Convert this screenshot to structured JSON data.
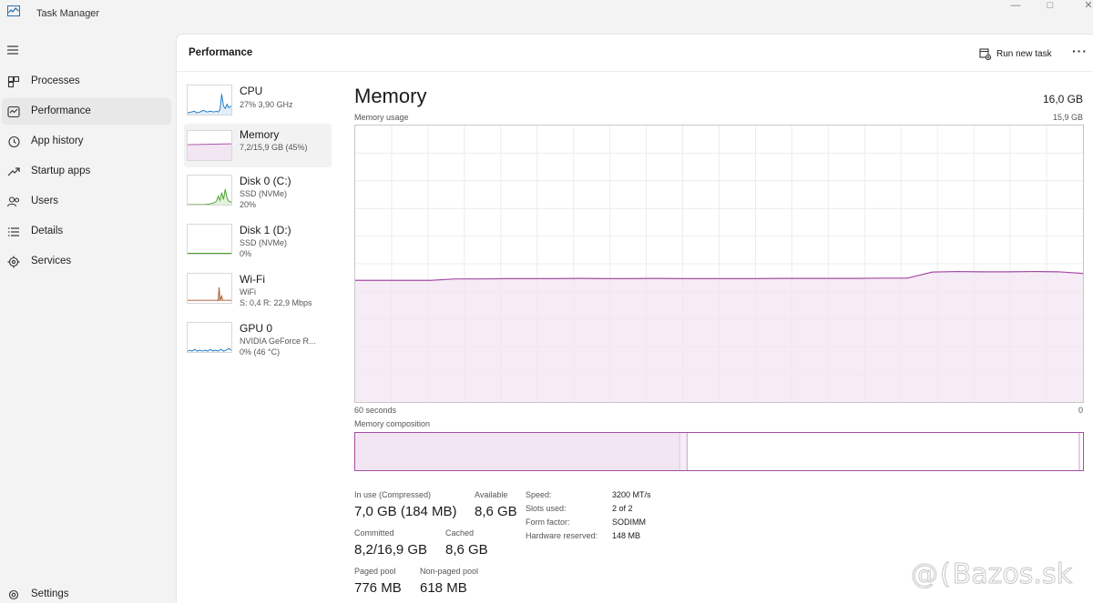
{
  "window": {
    "title": "Task Manager",
    "minimize": "—",
    "maximize": "□",
    "close": "✕"
  },
  "nav": {
    "items": [
      {
        "label": "Processes",
        "icon": "processes-icon"
      },
      {
        "label": "Performance",
        "icon": "performance-icon",
        "active": true
      },
      {
        "label": "App history",
        "icon": "app-history-icon"
      },
      {
        "label": "Startup apps",
        "icon": "startup-apps-icon"
      },
      {
        "label": "Users",
        "icon": "users-icon"
      },
      {
        "label": "Details",
        "icon": "details-icon"
      },
      {
        "label": "Services",
        "icon": "services-icon"
      }
    ],
    "settings": "Settings"
  },
  "header": {
    "title": "Performance",
    "run_new_task": "Run new task",
    "more": "···"
  },
  "devices": [
    {
      "name": "CPU",
      "sub1": "27% 3,90 GHz",
      "sub2": "",
      "sub3": "",
      "color": "#1c7ac8"
    },
    {
      "name": "Memory",
      "sub1": "7,2/15,9 GB (45%)",
      "sub2": "",
      "sub3": "",
      "color": "#a64ca6",
      "active": true
    },
    {
      "name": "Disk 0 (C:)",
      "sub1": "SSD (NVMe)",
      "sub2": "20%",
      "sub3": "",
      "color": "#4aa02c"
    },
    {
      "name": "Disk 1 (D:)",
      "sub1": "SSD (NVMe)",
      "sub2": "0%",
      "sub3": "",
      "color": "#4aa02c"
    },
    {
      "name": "Wi-Fi",
      "sub1": "WiFi",
      "sub2": "S: 0,4 R: 22,9 Mbps",
      "sub3": "",
      "color": "#a8562a"
    },
    {
      "name": "GPU 0",
      "sub1": "NVIDIA GeForce R...",
      "sub2": "0% (46 °C)",
      "sub3": "",
      "color": "#1c7ac8"
    }
  ],
  "memory": {
    "title": "Memory",
    "total": "16,0 GB",
    "usage_label": "Memory usage",
    "usage_max": "15,9 GB",
    "time_left": "60 seconds",
    "time_right": "0",
    "composition_label": "Memory composition",
    "composition": {
      "in_use_fraction": 0.446,
      "modified_fraction": 0.01,
      "free_fraction": 0.005
    },
    "usage_series": [
      0.44,
      0.44,
      0.44,
      0.44,
      0.445,
      0.445,
      0.446,
      0.446,
      0.446,
      0.447,
      0.446,
      0.446,
      0.447,
      0.446,
      0.446,
      0.446,
      0.446,
      0.447,
      0.447,
      0.447,
      0.447,
      0.448,
      0.448,
      0.47,
      0.472,
      0.471,
      0.471,
      0.472,
      0.471,
      0.465
    ],
    "stats": [
      {
        "label": "In use (Compressed)",
        "value": "7,0 GB (184 MB)"
      },
      {
        "label": "Available",
        "value": "8,6 GB"
      },
      {
        "label": "Committed",
        "value": "8,2/16,9 GB"
      },
      {
        "label": "Cached",
        "value": "8,6 GB"
      },
      {
        "label": "Paged pool",
        "value": "776 MB"
      },
      {
        "label": "Non-paged pool",
        "value": "618 MB"
      }
    ],
    "specs": [
      {
        "label": "Speed:",
        "value": "3200 MT/s"
      },
      {
        "label": "Slots used:",
        "value": "2 of 2"
      },
      {
        "label": "Form factor:",
        "value": "SODIMM"
      },
      {
        "label": "Hardware reserved:",
        "value": "148 MB"
      }
    ]
  },
  "watermark": {
    "at": "@",
    "paren": "(",
    "text": "Bazos.sk"
  },
  "colors": {
    "memory": "#a64ca6",
    "memory_fill": "#f1e6f1",
    "grid": "#ececec"
  }
}
